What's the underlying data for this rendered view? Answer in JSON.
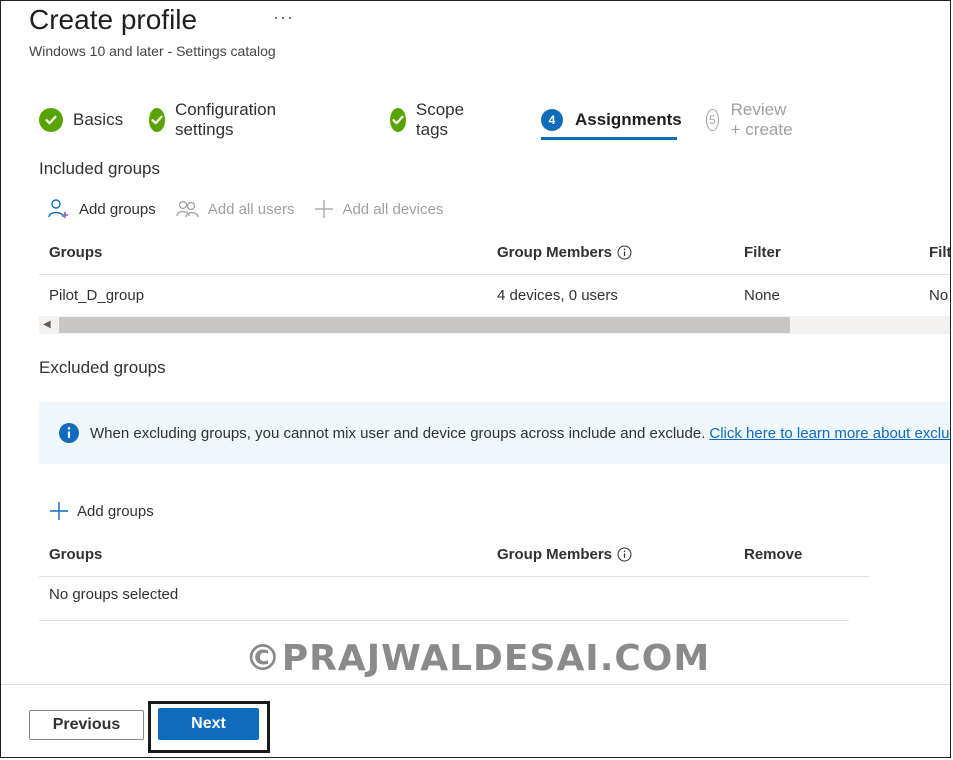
{
  "header": {
    "title": "Create profile",
    "more_label": "···",
    "subtitle": "Windows 10 and later - Settings catalog"
  },
  "steps": [
    {
      "label": "Basics",
      "state": "done"
    },
    {
      "label": "Configuration settings",
      "state": "done"
    },
    {
      "label": "Scope tags",
      "state": "done"
    },
    {
      "label": "Assignments",
      "state": "active",
      "number": "4"
    },
    {
      "label": "Review + create",
      "state": "disabled",
      "number": "5"
    }
  ],
  "included": {
    "heading": "Included groups",
    "commands": {
      "add_groups": "Add groups",
      "add_all_users": "Add all users",
      "add_all_devices": "Add all devices"
    },
    "columns": {
      "groups": "Groups",
      "group_members": "Group Members",
      "filter": "Filter",
      "filter_mode": "Filt"
    },
    "rows": [
      {
        "group": "Pilot_D_group",
        "members": "4 devices, 0 users",
        "filter": "None",
        "filter_mode": "No"
      }
    ]
  },
  "excluded": {
    "heading": "Excluded groups",
    "info_text": "When excluding groups, you cannot mix user and device groups across include and exclude.",
    "info_link": "Click here to learn more about exclud",
    "add_groups": "Add groups",
    "columns": {
      "groups": "Groups",
      "group_members": "Group Members",
      "remove": "Remove"
    },
    "empty_text": "No groups selected"
  },
  "footer": {
    "previous_label": "Previous",
    "next_label": "Next"
  },
  "watermark": "©PRAJWALDESAI.COM",
  "colors": {
    "accent": "#0f6cbd",
    "success": "#57a300",
    "info_background": "#eff6fc"
  }
}
